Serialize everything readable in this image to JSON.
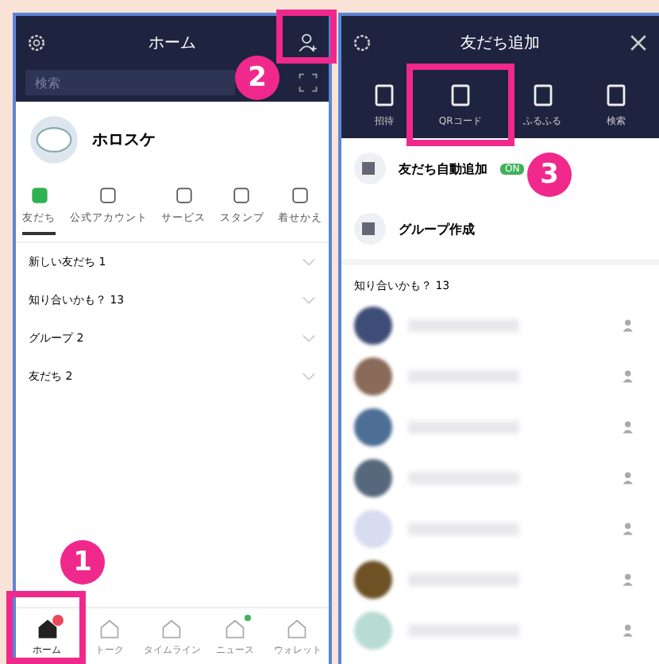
{
  "home_screen": {
    "title": "ホーム",
    "search": {
      "placeholder": "検索"
    },
    "profile": {
      "name": "ホロスケ"
    },
    "service_tabs": [
      {
        "label": "友だち",
        "selected": true
      },
      {
        "label": "公式アカウント",
        "selected": false
      },
      {
        "label": "サービス",
        "selected": false
      },
      {
        "label": "スタンプ",
        "selected": false
      },
      {
        "label": "着せかえ",
        "selected": false
      }
    ],
    "sections": [
      {
        "label": "新しい友だち 1"
      },
      {
        "label": "知り合いかも？ 13"
      },
      {
        "label": "グループ 2"
      },
      {
        "label": "友だち 2"
      }
    ],
    "nav": [
      {
        "label": "ホーム",
        "selected": true,
        "notification": true
      },
      {
        "label": "トーク",
        "selected": false,
        "notification": false
      },
      {
        "label": "タイムライン",
        "selected": false,
        "notification": false
      },
      {
        "label": "ニュース",
        "selected": false,
        "notification": true
      },
      {
        "label": "ウォレット",
        "selected": false,
        "notification": false
      }
    ]
  },
  "add_friends_screen": {
    "title": "友だち追加",
    "tabs": [
      {
        "label": "招待"
      },
      {
        "label": "QRコード"
      },
      {
        "label": "ふるふる"
      },
      {
        "label": "検索"
      }
    ],
    "options": [
      {
        "title": "友だち自動追加",
        "badge": "ON"
      },
      {
        "title": "グループ作成"
      }
    ],
    "suggestions_heading": "知り合いかも？ 13",
    "suggestions": [
      {
        "color": "#3d4d78"
      },
      {
        "color": "#8a6a58"
      },
      {
        "color": "#4d6f96"
      },
      {
        "color": "#56687c"
      },
      {
        "color": "#d8dcf0"
      },
      {
        "color": "#6e5226"
      },
      {
        "color": "#b8dcd4"
      }
    ]
  },
  "callouts": [
    {
      "number": "1"
    },
    {
      "number": "2"
    },
    {
      "number": "3"
    }
  ]
}
